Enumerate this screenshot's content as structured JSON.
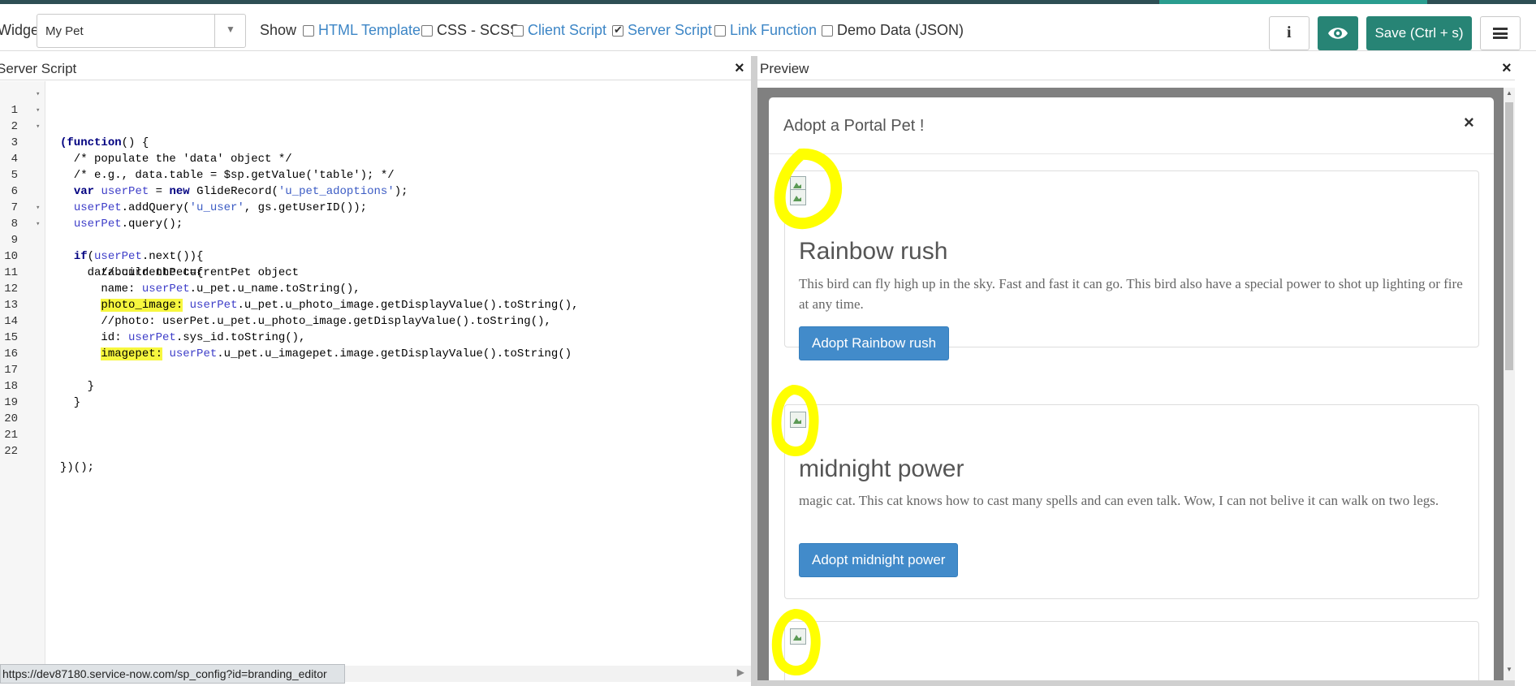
{
  "toolbar": {
    "widget_label": "Widget",
    "widget_value": "My Pet",
    "show_label": "Show",
    "checkboxes": [
      {
        "label": "HTML Template",
        "checked": false
      },
      {
        "label": "CSS - SCSS",
        "checked": false
      },
      {
        "label": "Client Script",
        "checked": false
      },
      {
        "label": "Server Script",
        "checked": true
      },
      {
        "label": "Link Function",
        "checked": false
      },
      {
        "label": "Demo Data (JSON)",
        "checked": false
      }
    ],
    "info_label": "i",
    "save_label": "Save (Ctrl + s)",
    "accent_color": "#278475",
    "link_color": "#3d86c6"
  },
  "server_script": {
    "title": "Server Script",
    "close": "×"
  },
  "code_lines": [
    "(function() {",
    "  /* populate the 'data' object */",
    "  /* e.g., data.table = $sp.getValue('table'); */",
    "",
    "  var userPet = new GlideRecord('u_pet_adoptions');",
    "  userPet.addQuery('u_user', gs.getUserID());",
    "  userPet.query();",
    "  if(userPet.next()){",
    "    data.currentPet={",
    "      //build the currentPet object",
    "      name: userPet.u_pet.u_name.toString(),",
    "      photo_image: userPet.u_pet.u_photo_image.getDisplayValue().toString(),",
    "      //photo: userPet.u_pet.u_photo_image.getDisplayValue().toString(),",
    "      id: userPet.sys_id.toString(),",
    "      imagepet: userPet.u_pet.u_imagepet.image.getDisplayValue().toString()",
    "",
    "    }",
    "  }",
    "",
    "",
    "",
    "})();"
  ],
  "line_numbers": [
    "1",
    "2",
    "3",
    "4",
    "5",
    "6",
    "7",
    "8",
    "9",
    "10",
    "11",
    "12",
    "13",
    "14",
    "15",
    "16",
    "17",
    "18",
    "19",
    "20",
    "21",
    "22"
  ],
  "fold_marker": "▾",
  "status_url": "https://dev87180.service-now.com/sp_config?id=branding_editor",
  "preview": {
    "title": "Preview",
    "close": "×",
    "modal_title": "Adopt a Portal Pet !",
    "modal_close": "×",
    "pets": [
      {
        "name": "Rainbow rush",
        "description": "This bird can fly high up in the sky. Fast and fast it can go. This bird also have a special power to shot up lighting or fire at any time.",
        "button": "Adopt Rainbow rush"
      },
      {
        "name": "midnight power",
        "description": "magic cat. This cat knows how to cast many spells and can even talk. Wow, I can not belive it can walk on two legs.",
        "button": "Adopt midnight power"
      }
    ],
    "highlight_color": "#ffff00"
  }
}
